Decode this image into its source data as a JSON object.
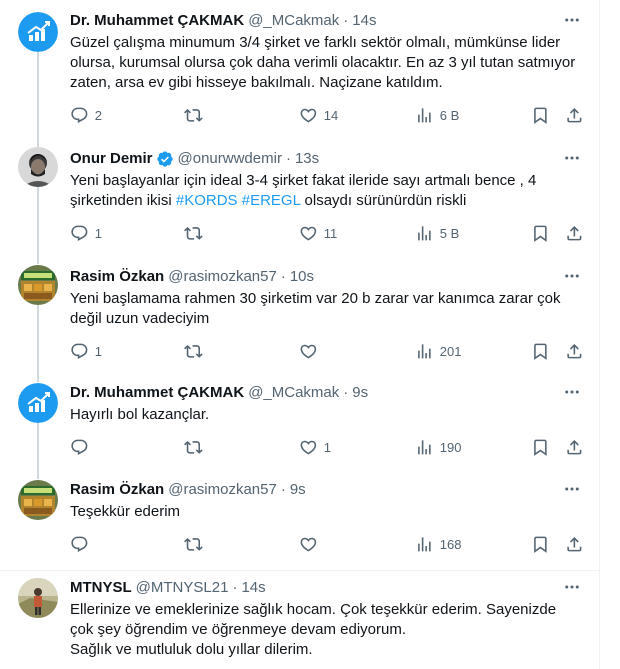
{
  "tweets": [
    {
      "name": "Dr. Muhammet ÇAKMAK",
      "handle": "@_MCakmak",
      "time": "14s",
      "verified": false,
      "avatar": "chart-logo",
      "text": "Güzel çalışma minumum 3/4 şirket ve farklı sektör olmalı, mümkünse lider olursa, kurumsal olursa çok daha verimli olacaktır. En az 3 yıl tutan satmıyor zaten, arsa ev gibi hisseye bakılmalı. Naçizane katıldım.",
      "replies": "2",
      "retweets": "",
      "likes": "14",
      "views": "6 B"
    },
    {
      "name": "Onur Demir",
      "handle": "@onurwwdemir",
      "time": "13s",
      "verified": true,
      "avatar": "person-photo",
      "text_parts": [
        "Yeni başlayanlar için ideal 3-4 şirket fakat ileride sayı artmalı bence , 4 şirketinden ikisi ",
        "#KORDS",
        " ",
        "#EREGL",
        " olsaydı sürünürdün riskli"
      ],
      "replies": "1",
      "retweets": "",
      "likes": "11",
      "views": "5 B"
    },
    {
      "name": "Rasim Özkan",
      "handle": "@rasimozkan57",
      "time": "10s",
      "verified": false,
      "avatar": "shop-photo",
      "text": "Yeni başlamama rahmen 30 şirketim var 20 b zarar var kanımca zarar çok değil uzun vadeciyim",
      "replies": "1",
      "retweets": "",
      "likes": "",
      "views": "201"
    },
    {
      "name": "Dr. Muhammet ÇAKMAK",
      "handle": "@_MCakmak",
      "time": "9s",
      "verified": false,
      "avatar": "chart-logo",
      "text": "Hayırlı bol kazançlar.",
      "replies": "",
      "retweets": "",
      "likes": "1",
      "views": "190"
    },
    {
      "name": "Rasim Özkan",
      "handle": "@rasimozkan57",
      "time": "9s",
      "verified": false,
      "avatar": "shop-photo",
      "text": "Teşekkür ederim",
      "replies": "",
      "retweets": "",
      "likes": "",
      "views": "168"
    },
    {
      "name": "MTNYSL",
      "handle": "@MTNYSL21",
      "time": "14s",
      "verified": false,
      "avatar": "person-outdoor",
      "text": "Ellerinize ve emeklerinize sağlık hocam. Çok teşekkür ederim. Sayenizde çok şey öğrendim ve öğrenmeye devam ediyorum.\nSağlık ve mutluluk dolu yıllar dilerim."
    }
  ],
  "icons": {
    "reply": "reply-icon",
    "retweet": "retweet-icon",
    "like": "heart-icon",
    "views": "views-icon",
    "bookmark": "bookmark-icon",
    "share": "share-icon",
    "more": "more-icon",
    "verified": "verified-badge-icon"
  },
  "colors": {
    "text": "#0f1419",
    "secondary": "#536471",
    "accent": "#1d9bf0",
    "divider": "#eff3f4",
    "thread_line": "#cfd9de"
  }
}
